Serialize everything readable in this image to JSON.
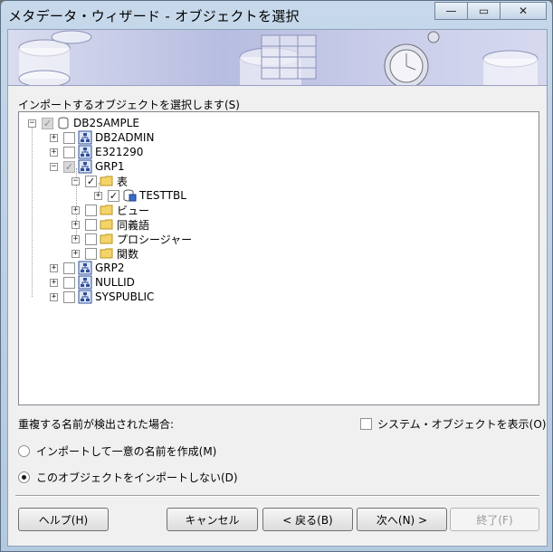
{
  "window": {
    "title": "メタデータ・ウィザード - オブジェクトを選択",
    "minimize": "—",
    "restore": "▭",
    "close": "✕"
  },
  "instruction": "インポートするオブジェクトを選択します(S)",
  "tree": {
    "root": "DB2SAMPLE",
    "schemas": [
      "DB2ADMIN",
      "E321290",
      "GRP1",
      "GRP2",
      "NULLID",
      "SYSPUBLIC"
    ],
    "folders": [
      "表",
      "ビュー",
      "同義語",
      "プロシージャー",
      "関数"
    ],
    "table": "TESTTBL",
    "expand_plus": "+",
    "expand_minus": "−",
    "check_mark": "✓"
  },
  "options": {
    "duplicate_label": "重複する名前が検出された場合:",
    "show_system": "システム・オブジェクトを表示(O)",
    "radio_create": "インポートして一意の名前を作成(M)",
    "radio_skip": "このオブジェクトをインポートしない(D)"
  },
  "buttons": {
    "help": "ヘルプ(H)",
    "cancel": "キャンセル",
    "back": "< 戻る(B)",
    "next": "次へ(N) >",
    "finish": "終了(F)"
  },
  "colors": {
    "titlebar": "#c6d8ea",
    "banner": "#b7bde0",
    "schema_icon": "#2e4f9c",
    "folder": "#f4d469"
  }
}
